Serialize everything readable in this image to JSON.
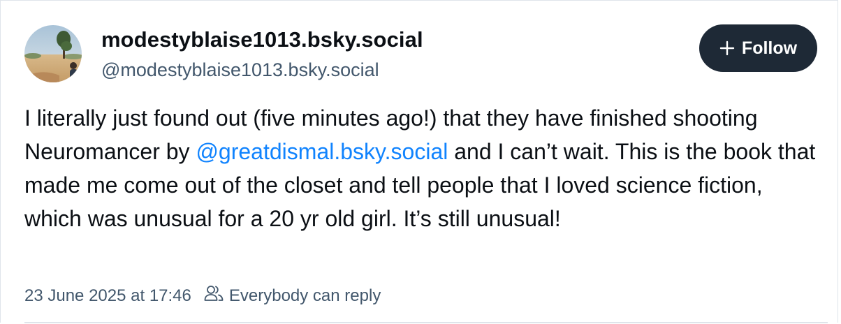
{
  "author": {
    "display_name": "modestyblaise1013.bsky.social",
    "handle": "@modestyblaise1013.bsky.social"
  },
  "follow_button": {
    "label": "Follow",
    "icon": "plus-icon"
  },
  "post": {
    "text_part_1": "I literally just found out (five minutes ago!) that they have finished shooting Neuromancer by ",
    "mention": "@greatdismal.bsky.social",
    "text_part_2": " and I can’t wait. This is the book that made me come out of the closet and tell people that I loved science fiction, which was unusual for a 20 yr old girl. It’s still unusual!"
  },
  "meta": {
    "timestamp": "23 June 2025 at 17:46",
    "reply_setting": "Everybody can reply",
    "reply_icon": "people-icon"
  },
  "colors": {
    "button_bg": "#1e2936",
    "mention": "#1083fe",
    "muted_text": "#42576c",
    "border": "#dfe4ea"
  }
}
